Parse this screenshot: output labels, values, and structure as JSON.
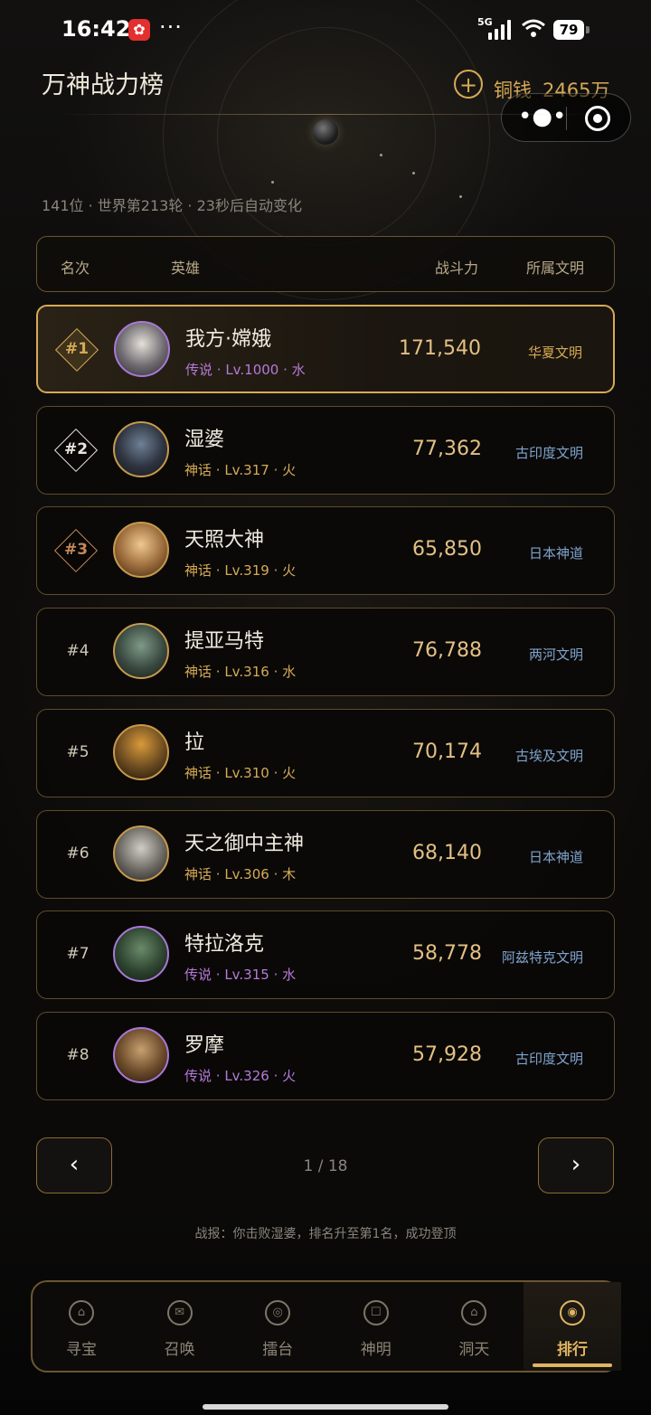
{
  "status_bar": {
    "time": "16:42",
    "more": "···",
    "network": "5G",
    "battery": "79"
  },
  "header": {
    "title": "万神战力榜",
    "add_symbol": "+",
    "coin_label": "铜钱",
    "coin_value": "2465万"
  },
  "subinfo": "141位 · 世界第213轮 · 23秒后自动变化",
  "table": {
    "headers": {
      "rank": "名次",
      "hero": "英雄",
      "power": "战斗力",
      "civilization": "所属文明"
    },
    "rows": [
      {
        "rank": "#1",
        "name": "我方·嫦娥",
        "tier": "传说",
        "level": "Lv.1000",
        "element": "水",
        "power": "171,540",
        "civilization": "华夏文明",
        "tier_color": "#b67ad8",
        "highlight": true
      },
      {
        "rank": "#2",
        "name": "湿婆",
        "tier": "神话",
        "level": "Lv.317",
        "element": "火",
        "power": "77,362",
        "civilization": "古印度文明",
        "tier_color": "#d6aa55"
      },
      {
        "rank": "#3",
        "name": "天照大神",
        "tier": "神话",
        "level": "Lv.319",
        "element": "火",
        "power": "65,850",
        "civilization": "日本神道",
        "tier_color": "#d6aa55"
      },
      {
        "rank": "#4",
        "name": "提亚马特",
        "tier": "神话",
        "level": "Lv.316",
        "element": "水",
        "power": "76,788",
        "civilization": "两河文明",
        "tier_color": "#d6aa55"
      },
      {
        "rank": "#5",
        "name": "拉",
        "tier": "神话",
        "level": "Lv.310",
        "element": "火",
        "power": "70,174",
        "civilization": "古埃及文明",
        "tier_color": "#d6aa55"
      },
      {
        "rank": "#6",
        "name": "天之御中主神",
        "tier": "神话",
        "level": "Lv.306",
        "element": "木",
        "power": "68,140",
        "civilization": "日本神道",
        "tier_color": "#d6aa55"
      },
      {
        "rank": "#7",
        "name": "特拉洛克",
        "tier": "传说",
        "level": "Lv.315",
        "element": "水",
        "power": "58,778",
        "civilization": "阿兹特克文明",
        "tier_color": "#b67ad8"
      },
      {
        "rank": "#8",
        "name": "罗摩",
        "tier": "传说",
        "level": "Lv.326",
        "element": "火",
        "power": "57,928",
        "civilization": "古印度文明",
        "tier_color": "#b67ad8"
      }
    ]
  },
  "pagination": {
    "prev": "‹",
    "next": "›",
    "info": "1 / 18"
  },
  "battle_report": "战报：你击败湿婆，排名升至第1名，成功登顶",
  "tabs": [
    {
      "label": "寻宝",
      "active": false
    },
    {
      "label": "召唤",
      "active": false
    },
    {
      "label": "擂台",
      "active": false
    },
    {
      "label": "神明",
      "active": false
    },
    {
      "label": "洞天",
      "active": false
    },
    {
      "label": "排行",
      "active": true
    }
  ],
  "colors": {
    "accent_gold": "#d6aa55",
    "legend_purple": "#b67ad8",
    "civ_blue": "#7fa3cc"
  }
}
